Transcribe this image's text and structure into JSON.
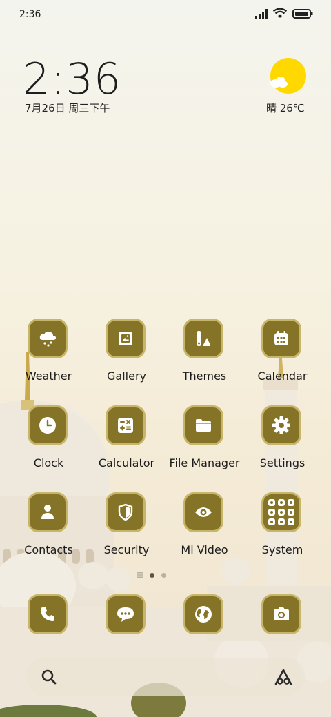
{
  "status_bar": {
    "time": "2:36"
  },
  "lockclock": {
    "time": "2:36",
    "date": "7月26日 周三下午"
  },
  "weather": {
    "condition_temp": "晴 26℃"
  },
  "apps": [
    {
      "label": "Weather",
      "icon": "cloud-snow-icon"
    },
    {
      "label": "Gallery",
      "icon": "image-icon"
    },
    {
      "label": "Themes",
      "icon": "themes-icon"
    },
    {
      "label": "Calendar",
      "icon": "calendar-icon"
    },
    {
      "label": "Clock",
      "icon": "clock-icon"
    },
    {
      "label": "Calculator",
      "icon": "calculator-icon"
    },
    {
      "label": "File Manager",
      "icon": "folder-icon"
    },
    {
      "label": "Settings",
      "icon": "gear-icon"
    },
    {
      "label": "Contacts",
      "icon": "person-icon"
    },
    {
      "label": "Security",
      "icon": "shield-icon"
    },
    {
      "label": "Mi Video",
      "icon": "eye-icon"
    },
    {
      "label": "System",
      "icon": "folder-grid-icon"
    }
  ],
  "dock": [
    {
      "icon": "phone-icon"
    },
    {
      "icon": "message-icon"
    },
    {
      "icon": "globe-icon"
    },
    {
      "icon": "camera-icon"
    }
  ],
  "colors": {
    "icon_bg": "#857428",
    "icon_border": "#c7b56a",
    "sun": "#ffd800"
  }
}
